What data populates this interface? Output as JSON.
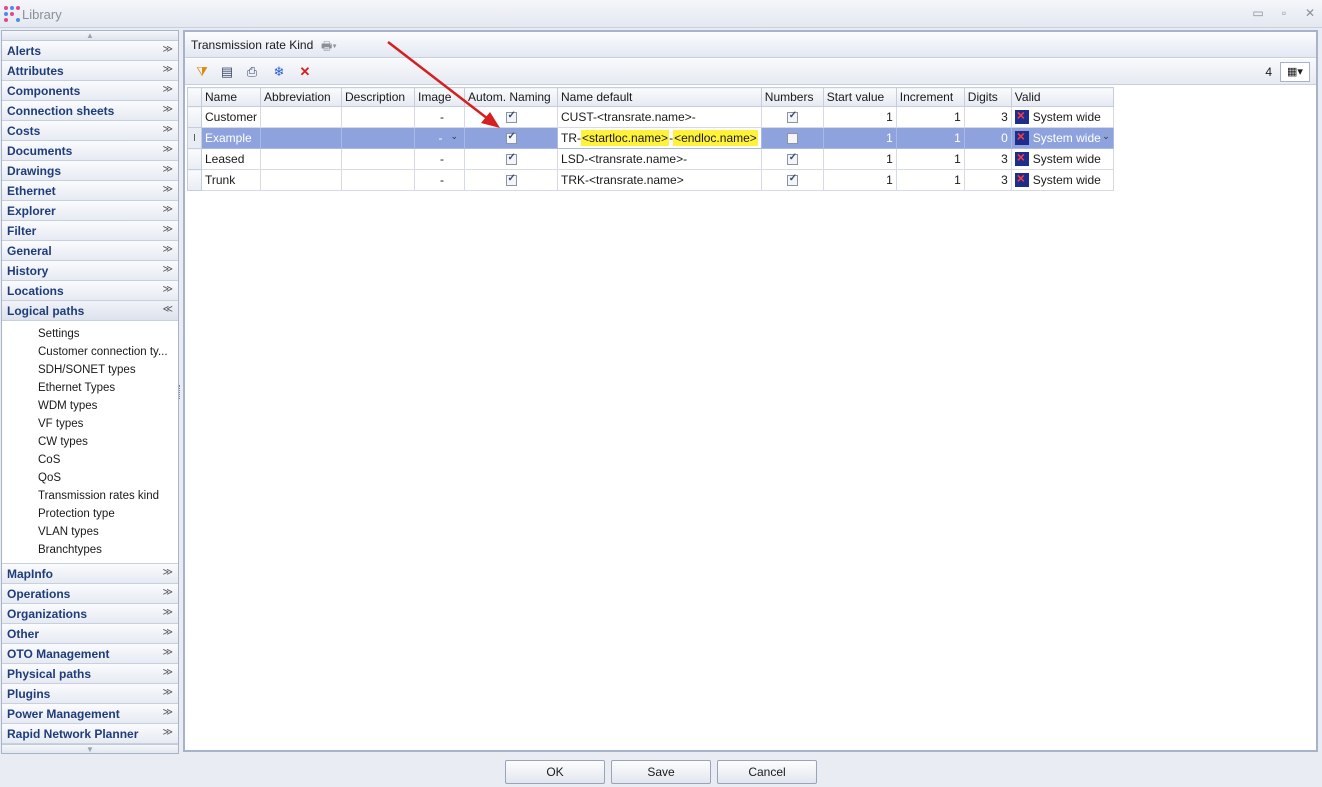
{
  "window": {
    "title": "Library",
    "minimize": "▭",
    "maximize": "▫",
    "close": "✕"
  },
  "nav": {
    "groups_top": [
      {
        "label": "Alerts",
        "chevron": "≫"
      },
      {
        "label": "Attributes",
        "chevron": "≫"
      },
      {
        "label": "Components",
        "chevron": "≫"
      },
      {
        "label": "Connection sheets",
        "chevron": "≫"
      },
      {
        "label": "Costs",
        "chevron": "≫"
      },
      {
        "label": "Documents",
        "chevron": "≫"
      },
      {
        "label": "Drawings",
        "chevron": "≫"
      },
      {
        "label": "Ethernet",
        "chevron": "≫"
      },
      {
        "label": "Explorer",
        "chevron": "≫"
      },
      {
        "label": "Filter",
        "chevron": "≫"
      },
      {
        "label": "General",
        "chevron": "≫"
      },
      {
        "label": "History",
        "chevron": "≫"
      },
      {
        "label": "Locations",
        "chevron": "≫"
      }
    ],
    "expanded_group": {
      "label": "Logical paths",
      "chevron": "≪"
    },
    "subitems": [
      "Settings",
      "Customer connection ty...",
      "SDH/SONET types",
      "Ethernet Types",
      "WDM types",
      "VF types",
      "CW types",
      "CoS",
      "QoS",
      "Transmission rates kind",
      "Protection type",
      "VLAN types",
      "Branchtypes"
    ],
    "groups_bottom": [
      {
        "label": "MapInfo",
        "chevron": "≫"
      },
      {
        "label": "Operations",
        "chevron": "≫"
      },
      {
        "label": "Organizations",
        "chevron": "≫"
      },
      {
        "label": "Other",
        "chevron": "≫"
      },
      {
        "label": "OTO Management",
        "chevron": "≫"
      },
      {
        "label": "Physical paths",
        "chevron": "≫"
      },
      {
        "label": "Plugins",
        "chevron": "≫"
      },
      {
        "label": "Power Management",
        "chevron": "≫"
      },
      {
        "label": "Rapid Network Planner",
        "chevron": "≫"
      }
    ]
  },
  "panel": {
    "title": "Transmission rate Kind",
    "record_count": "4"
  },
  "grid": {
    "columns": [
      "Name",
      "Abbreviation",
      "Description",
      "Image",
      "Autom. Naming",
      "Name default",
      "Numbers",
      "Start value",
      "Increment",
      "Digits",
      "Valid"
    ],
    "rows": [
      {
        "name": "Customer",
        "abbreviation": "",
        "description": "",
        "image": "-",
        "autom_naming": true,
        "name_default": "CUST-<transrate.name>-",
        "numbers": true,
        "start_value": "1",
        "increment": "1",
        "digits": "3",
        "valid": "System wide"
      },
      {
        "name": "Example",
        "abbreviation": "",
        "description": "",
        "image": "-",
        "autom_naming": true,
        "name_default_prefix": "TR-",
        "name_default_token1": "<startloc.name>",
        "name_default_sep": "-",
        "name_default_token2": "<endloc.name>",
        "numbers": false,
        "start_value": "1",
        "increment": "1",
        "digits": "0",
        "valid": "System wide"
      },
      {
        "name": "Leased",
        "abbreviation": "",
        "description": "",
        "image": "-",
        "autom_naming": true,
        "name_default": "LSD-<transrate.name>-",
        "numbers": true,
        "start_value": "1",
        "increment": "1",
        "digits": "3",
        "valid": "System wide"
      },
      {
        "name": "Trunk",
        "abbreviation": "",
        "description": "",
        "image": "-",
        "autom_naming": true,
        "name_default": "TRK-<transrate.name>",
        "numbers": true,
        "start_value": "1",
        "increment": "1",
        "digits": "3",
        "valid": "System wide"
      }
    ]
  },
  "buttons": {
    "ok": "OK",
    "save": "Save",
    "cancel": "Cancel"
  },
  "colors": {
    "selection": "#8ea2dd",
    "highlight": "#fff23a",
    "annotation_arrow": "#d42020",
    "nav_text": "#1f3d7a"
  },
  "icons": {
    "toolbar": [
      "filter-edit-icon",
      "columns-icon",
      "print-icon",
      "freeze-icon",
      "delete-icon"
    ]
  }
}
